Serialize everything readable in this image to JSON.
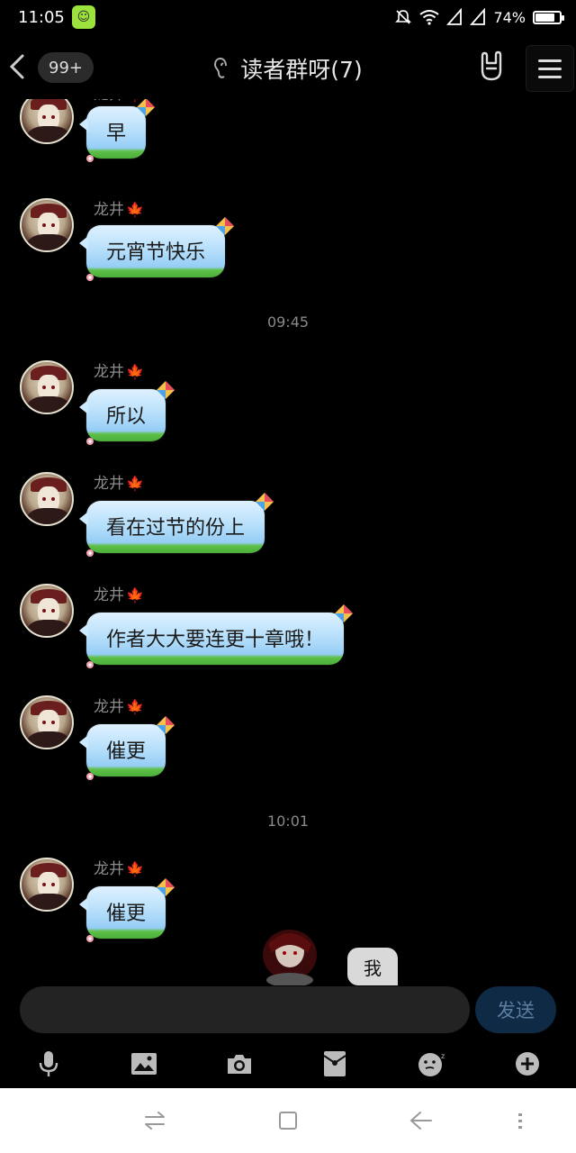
{
  "status_bar": {
    "time": "11:05",
    "battery_percent": "74%",
    "battery_level": 0.74
  },
  "header": {
    "back_icon": "chevron-left-icon",
    "unread_count": "99+",
    "title": "读者群呀(7)",
    "ear_icon": "ear-icon",
    "gesture_icon": "rock-hand-icon",
    "menu_icon": "menu-icon"
  },
  "messages": [
    {
      "sender": "龙井",
      "text": "早"
    },
    {
      "sender": "龙井",
      "text": "元宵节快乐"
    },
    {
      "sender": "龙井",
      "text": "所以"
    },
    {
      "sender": "龙井",
      "text": "看在过节的份上"
    },
    {
      "sender": "龙井",
      "text": "作者大大要连更十章哦！"
    },
    {
      "sender": "龙井",
      "text": "催更"
    },
    {
      "sender": "龙井",
      "text": "催更"
    }
  ],
  "timestamps": [
    "09:45",
    "10:01"
  ],
  "me_label": "我",
  "input": {
    "value": "",
    "placeholder": "",
    "send_label": "发送"
  },
  "toolbar": {
    "items": [
      "microphone-icon",
      "image-icon",
      "camera-icon",
      "red-packet-icon",
      "emoji-icon",
      "plus-icon"
    ]
  },
  "navbar": {
    "items": [
      "switch-icon",
      "square-icon",
      "back-arrow-icon",
      "more-icon"
    ]
  },
  "colors": {
    "background": "#000000",
    "bubble_blue": "#b8e0fb",
    "bubble_green": "#4aae3a",
    "send_button": "#0f2a44",
    "sender_leaf": "#b5773a"
  }
}
